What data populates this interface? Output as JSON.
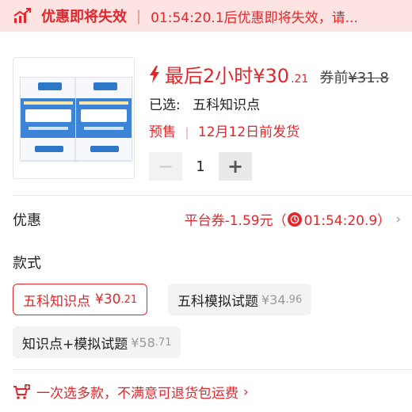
{
  "banner": {
    "icon": "trend-up-icon",
    "title": "优惠即将失效",
    "separator": "|",
    "message": "01:54:20.1后优惠即将失效，请..."
  },
  "product": {
    "image_icon": "book-covers-thumbnail",
    "price_main": "最后2小时¥30",
    "price_decimal": ".21",
    "price_before_label": "券前",
    "price_old": "¥31.8",
    "selected_label": "已选:",
    "selected_value": "五科知识点",
    "presale_label": "预售",
    "presale_sep": "|",
    "presale_date": "12月12日前发货"
  },
  "quantity": {
    "minus": "−",
    "value": "1",
    "plus": "+"
  },
  "coupon": {
    "label": "优惠",
    "text": "平台券-1.59元（",
    "countdown": "01:54:20.9）",
    "chevron": "›"
  },
  "spec": {
    "title": "款式",
    "options": [
      {
        "label": "五科知识点",
        "price_main": "¥30",
        "price_dec": ".21",
        "selected": true
      },
      {
        "label": "五科模拟试题",
        "price_main": "¥34",
        "price_dec": ".96",
        "selected": false
      },
      {
        "label": "知识点+模拟试题",
        "price_main": "¥58",
        "price_dec": ".71",
        "selected": false
      }
    ]
  },
  "promo": {
    "icon": "cart-plus-icon",
    "text": "一次选多款，不满意可退货包运费",
    "chevron": "›"
  },
  "colors": {
    "accent": "#e3262b",
    "banner_bg": "#fde3e1",
    "chip_bg": "#f3f3f3"
  }
}
